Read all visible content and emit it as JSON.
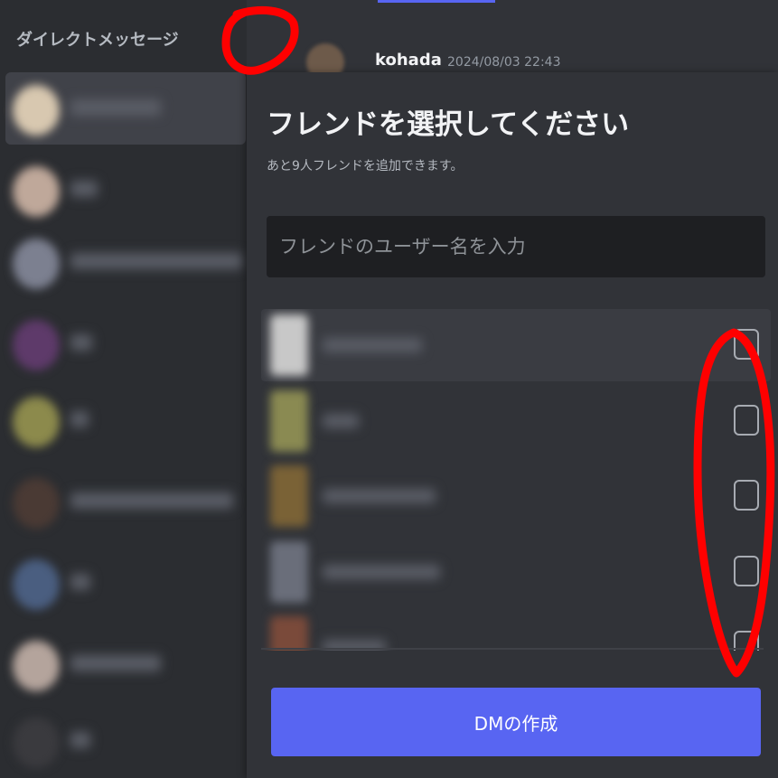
{
  "sidebar": {
    "header": "ダイレクトメッセージ",
    "add_icon": "+"
  },
  "chat": {
    "author": "kohada",
    "timestamp": "2024/08/03 22:43"
  },
  "dialog": {
    "title": "フレンドを選択してください",
    "subtitle": "あと9人フレンドを追加できます。",
    "search_placeholder": "フレンドのユーザー名を入力",
    "create_button": "DMの作成"
  },
  "colors": {
    "accent": "#5865f2",
    "annotation": "#ff0000"
  }
}
